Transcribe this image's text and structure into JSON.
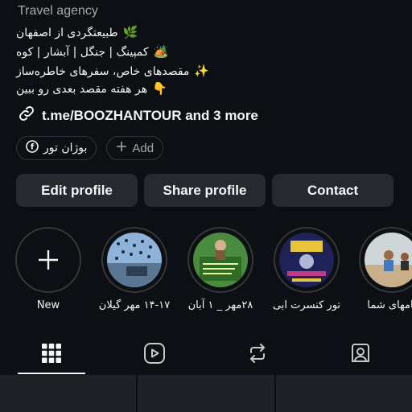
{
  "profile": {
    "category": "Travel agency",
    "bio": [
      {
        "text": "طبیعتگردی از اصفهان",
        "emoji": "🌿"
      },
      {
        "text": "کمپینگ | جنگل | آبشار | کوه",
        "emoji": "🏕️"
      },
      {
        "text": "مقصدهای خاص، سفرهای خاطره‌ساز",
        "emoji": "✨"
      },
      {
        "text": "هر هفته مقصد بعدی رو ببین",
        "emoji": "👇"
      }
    ],
    "link_text": "t.me/BOOZHANTOUR and 3 more"
  },
  "chips": {
    "threads_label": "بوژان تور",
    "add_label": "Add"
  },
  "buttons": {
    "edit": "Edit profile",
    "share": "Share profile",
    "contact": "Contact"
  },
  "highlights": [
    {
      "label": "New",
      "type": "new"
    },
    {
      "label": "۱۴-۱۷ مهر گیلان",
      "type": "cover",
      "color": "#6f95c4"
    },
    {
      "label": "۲۸مهر _ ۱ آبان",
      "type": "cover",
      "color": "#3f8a3a"
    },
    {
      "label": "تور کنسرت ابی",
      "type": "cover",
      "color": "#2a2c6a"
    },
    {
      "label": "تامهای شما",
      "type": "cover",
      "color": "#c9b48a"
    }
  ],
  "tabs": [
    {
      "name": "grid",
      "icon": "grid-icon"
    },
    {
      "name": "reels",
      "icon": "reels-icon"
    },
    {
      "name": "reposts",
      "icon": "repost-icon"
    },
    {
      "name": "tagged",
      "icon": "tagged-icon"
    }
  ]
}
